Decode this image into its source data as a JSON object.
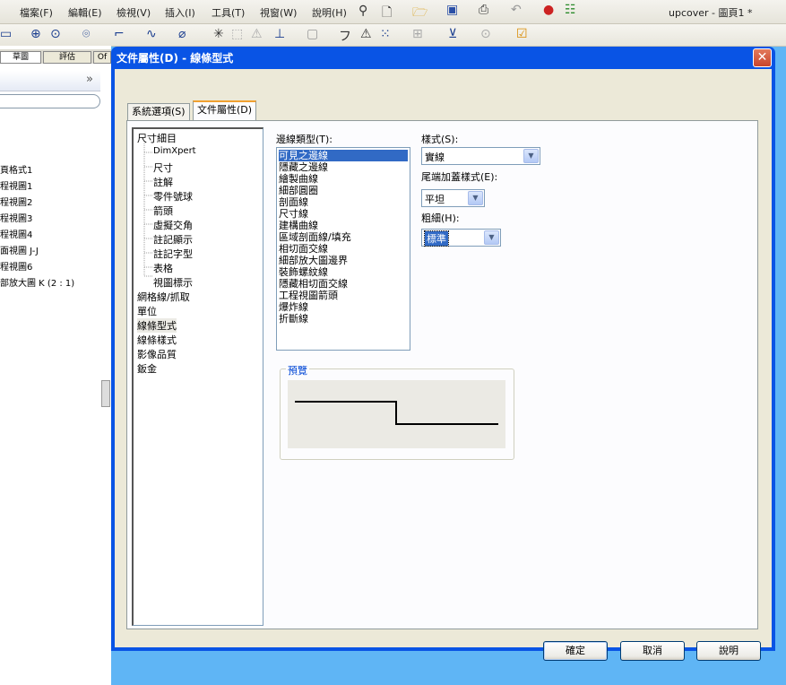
{
  "menubar": {
    "items": [
      "檔案(F)",
      "編輯(E)",
      "檢視(V)",
      "插入(I)",
      "工具(T)",
      "視窗(W)",
      "說明(H)"
    ],
    "title": "upcover - 圖頁1 *"
  },
  "left_pane": {
    "tabs": [
      "草圖",
      "評估",
      "Of"
    ],
    "rows": [
      "頁格式1",
      "程視圖1",
      "程視圖2",
      "程視圖3",
      "程視圖4",
      "面視圖 J-J",
      "程視圖6",
      "部放大圖 K (2 : 1)"
    ]
  },
  "dialog": {
    "title": "文件屬性(D) - 線條型式",
    "tabs": [
      "系統選項(S)",
      "文件屬性(D)"
    ],
    "tree": {
      "root": "尺寸細目",
      "children": [
        "DimXpert",
        "尺寸",
        "註解",
        "零件號球",
        "箭頭",
        "虛擬交角",
        "註記顯示",
        "註記字型",
        "表格",
        "視圖標示"
      ],
      "others": [
        "網格線/抓取",
        "單位",
        "線條型式",
        "線條樣式",
        "影像品質",
        "鈑金"
      ]
    },
    "edge_type": {
      "label": "邊線類型(T):",
      "items": [
        "可見之邊線",
        "隱藏之邊線",
        "繪製曲線",
        "細部圓圈",
        "剖面線",
        "尺寸線",
        "建構曲線",
        "區域剖面線/填充",
        "相切面交線",
        "細部放大圖邊界",
        "裝飾螺紋線",
        "隱藏相切面交線",
        "工程視圖箭頭",
        "爆炸線",
        "折斷線"
      ],
      "selected_index": 0
    },
    "style": {
      "label": "樣式(S):",
      "value": "實線"
    },
    "end_cap": {
      "label": "尾端加蓋樣式(E):",
      "value": "平坦"
    },
    "thickness": {
      "label": "粗細(H):",
      "value": "標準"
    },
    "preview_label": "預覽",
    "buttons": {
      "ok": "確定",
      "cancel": "取消",
      "help": "說明"
    },
    "close_symbol": "✕"
  }
}
